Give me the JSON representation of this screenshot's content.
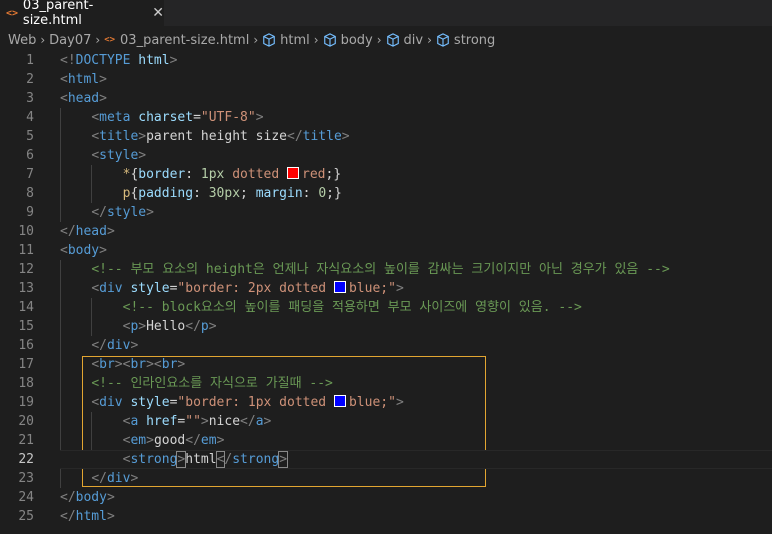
{
  "tab": {
    "icon": "<>",
    "title": "03_parent-size.html",
    "close": "✕"
  },
  "breadcrumb": {
    "items": [
      "Web",
      "Day07",
      "03_parent-size.html",
      "html",
      "body",
      "div",
      "strong"
    ]
  },
  "colors": {
    "red_swatch": "#ff0000",
    "blue_swatch": "#0000ff",
    "selection_border": "#e2a531"
  },
  "lines": [
    {
      "n": "1",
      "tokens": [
        [
          "p",
          "<!"
        ],
        [
          "t",
          "DOCTYPE"
        ],
        [
          "tx",
          " "
        ],
        [
          "a",
          "html"
        ],
        [
          "p",
          ">"
        ]
      ]
    },
    {
      "n": "2",
      "tokens": [
        [
          "p",
          "<"
        ],
        [
          "t",
          "html"
        ],
        [
          "p",
          ">"
        ]
      ]
    },
    {
      "n": "3",
      "tokens": [
        [
          "p",
          "<"
        ],
        [
          "t",
          "head"
        ],
        [
          "p",
          ">"
        ]
      ]
    },
    {
      "n": "4",
      "tokens": [
        [
          "tx",
          "    "
        ],
        [
          "p",
          "<"
        ],
        [
          "t",
          "meta"
        ],
        [
          "tx",
          " "
        ],
        [
          "a",
          "charset"
        ],
        [
          "tx",
          "="
        ],
        [
          "s",
          "\"UTF-8\""
        ],
        [
          "p",
          ">"
        ]
      ]
    },
    {
      "n": "5",
      "tokens": [
        [
          "tx",
          "    "
        ],
        [
          "p",
          "<"
        ],
        [
          "t",
          "title"
        ],
        [
          "p",
          ">"
        ],
        [
          "tx",
          "parent height size"
        ],
        [
          "p",
          "</"
        ],
        [
          "t",
          "title"
        ],
        [
          "p",
          ">"
        ]
      ]
    },
    {
      "n": "6",
      "tokens": [
        [
          "tx",
          "    "
        ],
        [
          "p",
          "<"
        ],
        [
          "t",
          "style"
        ],
        [
          "p",
          ">"
        ]
      ]
    },
    {
      "n": "7",
      "tokens": [
        [
          "tx",
          "        "
        ],
        [
          "sel",
          "*"
        ],
        [
          "tx",
          "{"
        ],
        [
          "a",
          "border"
        ],
        [
          "tx",
          ": "
        ],
        [
          "n",
          "1px"
        ],
        [
          "tx",
          " "
        ],
        [
          "v",
          "dotted "
        ],
        [
          "swatch-red",
          ""
        ],
        [
          "v",
          "red"
        ],
        [
          "tx",
          ";}"
        ]
      ]
    },
    {
      "n": "8",
      "tokens": [
        [
          "tx",
          "        "
        ],
        [
          "sel",
          "p"
        ],
        [
          "tx",
          "{"
        ],
        [
          "a",
          "padding"
        ],
        [
          "tx",
          ": "
        ],
        [
          "n",
          "30px"
        ],
        [
          "tx",
          "; "
        ],
        [
          "a",
          "margin"
        ],
        [
          "tx",
          ": "
        ],
        [
          "n",
          "0"
        ],
        [
          "tx",
          ";}"
        ]
      ]
    },
    {
      "n": "9",
      "tokens": [
        [
          "tx",
          "    "
        ],
        [
          "p",
          "</"
        ],
        [
          "t",
          "style"
        ],
        [
          "p",
          ">"
        ]
      ]
    },
    {
      "n": "10",
      "tokens": [
        [
          "p",
          "</"
        ],
        [
          "t",
          "head"
        ],
        [
          "p",
          ">"
        ]
      ]
    },
    {
      "n": "11",
      "tokens": [
        [
          "p",
          "<"
        ],
        [
          "t",
          "body"
        ],
        [
          "p",
          ">"
        ]
      ]
    },
    {
      "n": "12",
      "tokens": [
        [
          "tx",
          "    "
        ],
        [
          "c",
          "<!-- 부모 요소의 height은 언제나 자식요소의 높이를 감싸는 크기이지만 아닌 경우가 있음 -->"
        ]
      ]
    },
    {
      "n": "13",
      "tokens": [
        [
          "tx",
          "    "
        ],
        [
          "p",
          "<"
        ],
        [
          "t",
          "div"
        ],
        [
          "tx",
          " "
        ],
        [
          "a",
          "style"
        ],
        [
          "tx",
          "="
        ],
        [
          "s",
          "\"border: 2px dotted "
        ],
        [
          "swatch-blue",
          ""
        ],
        [
          "s",
          "blue;\""
        ],
        [
          "p",
          ">"
        ]
      ]
    },
    {
      "n": "14",
      "tokens": [
        [
          "tx",
          "        "
        ],
        [
          "c",
          "<!-- block요소의 높이를 패딩을 적용하면 부모 사이즈에 영향이 있음. -->"
        ]
      ]
    },
    {
      "n": "15",
      "tokens": [
        [
          "tx",
          "        "
        ],
        [
          "p",
          "<"
        ],
        [
          "t",
          "p"
        ],
        [
          "p",
          ">"
        ],
        [
          "tx",
          "Hello"
        ],
        [
          "p",
          "</"
        ],
        [
          "t",
          "p"
        ],
        [
          "p",
          ">"
        ]
      ]
    },
    {
      "n": "16",
      "tokens": [
        [
          "tx",
          "    "
        ],
        [
          "p",
          "</"
        ],
        [
          "t",
          "div"
        ],
        [
          "p",
          ">"
        ]
      ]
    },
    {
      "n": "17",
      "tokens": [
        [
          "tx",
          "    "
        ],
        [
          "p",
          "<"
        ],
        [
          "t",
          "br"
        ],
        [
          "p",
          "><"
        ],
        [
          "t",
          "br"
        ],
        [
          "p",
          "><"
        ],
        [
          "t",
          "br"
        ],
        [
          "p",
          ">"
        ]
      ]
    },
    {
      "n": "18",
      "tokens": [
        [
          "tx",
          "    "
        ],
        [
          "c",
          "<!-- 인라인요소를 자식으로 가질때 -->"
        ]
      ]
    },
    {
      "n": "19",
      "tokens": [
        [
          "tx",
          "    "
        ],
        [
          "p",
          "<"
        ],
        [
          "t",
          "div"
        ],
        [
          "tx",
          " "
        ],
        [
          "a",
          "style"
        ],
        [
          "tx",
          "="
        ],
        [
          "s",
          "\"border: 1px dotted "
        ],
        [
          "swatch-blue",
          ""
        ],
        [
          "s",
          "blue;\""
        ],
        [
          "p",
          ">"
        ]
      ]
    },
    {
      "n": "20",
      "tokens": [
        [
          "tx",
          "        "
        ],
        [
          "p",
          "<"
        ],
        [
          "t",
          "a"
        ],
        [
          "tx",
          " "
        ],
        [
          "a",
          "href"
        ],
        [
          "tx",
          "="
        ],
        [
          "s",
          "\"\""
        ],
        [
          "p",
          ">"
        ],
        [
          "tx",
          "nice"
        ],
        [
          "p",
          "</"
        ],
        [
          "t",
          "a"
        ],
        [
          "p",
          ">"
        ]
      ]
    },
    {
      "n": "21",
      "tokens": [
        [
          "tx",
          "        "
        ],
        [
          "p",
          "<"
        ],
        [
          "t",
          "em"
        ],
        [
          "p",
          ">"
        ],
        [
          "tx",
          "good"
        ],
        [
          "p",
          "</"
        ],
        [
          "t",
          "em"
        ],
        [
          "p",
          ">"
        ]
      ]
    },
    {
      "n": "22",
      "tokens": [
        [
          "tx",
          "        "
        ],
        [
          "p",
          "<"
        ],
        [
          "t",
          "strong"
        ],
        [
          "p-match",
          ">"
        ],
        [
          "tx",
          "html"
        ],
        [
          "p-match",
          "<"
        ],
        [
          "p",
          "/"
        ],
        [
          "t",
          "strong"
        ],
        [
          "p-match",
          ">"
        ]
      ],
      "current": true
    },
    {
      "n": "23",
      "tokens": [
        [
          "tx",
          "    "
        ],
        [
          "p",
          "</"
        ],
        [
          "t",
          "div"
        ],
        [
          "p",
          ">"
        ]
      ]
    },
    {
      "n": "24",
      "tokens": [
        [
          "p",
          "</"
        ],
        [
          "t",
          "body"
        ],
        [
          "p",
          ">"
        ]
      ]
    },
    {
      "n": "25",
      "tokens": [
        [
          "p",
          "</"
        ],
        [
          "t",
          "html"
        ],
        [
          "p",
          ">"
        ]
      ]
    }
  ]
}
